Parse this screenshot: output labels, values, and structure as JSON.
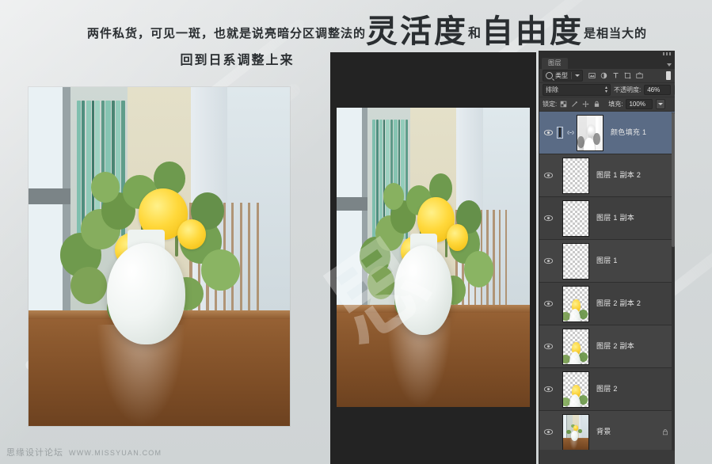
{
  "headline": {
    "line1_part1": "两件私货，可见一斑，也就是说亮暗分区调整法的",
    "line1_big1": "灵活度",
    "line1_conj": "和",
    "line1_big2": "自由度",
    "line1_tail": "是相当大的",
    "line2": "回到日系调整上来"
  },
  "photoshop": {
    "panel_tab": "图层",
    "filter": {
      "search_icon": "search-icon",
      "label": "类型",
      "dropdown_icon": "chevron-down-icon"
    },
    "filter_type_icons": [
      "pixel-layer-icon",
      "adjustment-layer-icon",
      "type-layer-icon",
      "shape-layer-icon",
      "smart-object-icon"
    ],
    "filter_toggle": "filter-enable-toggle",
    "blend_mode": "排除",
    "opacity_label": "不透明度:",
    "opacity_value": "46%",
    "lock_label": "锁定:",
    "lock_icons": [
      "lock-transparent-pixels-icon",
      "lock-image-pixels-icon",
      "lock-position-icon",
      "lock-all-icon"
    ],
    "fill_label": "填充:",
    "fill_value": "100%",
    "layers": [
      {
        "name": "颜色填充 1",
        "selected": true,
        "visible": true,
        "kind": "solid-color-fill",
        "has_mask": true,
        "fill_color": "#9e3c10",
        "locked": false
      },
      {
        "name": "图层 1 副本 2",
        "selected": false,
        "visible": true,
        "kind": "pixel",
        "has_mask": false,
        "locked": false
      },
      {
        "name": "图层 1 副本",
        "selected": false,
        "visible": true,
        "kind": "pixel",
        "has_mask": false,
        "locked": false
      },
      {
        "name": "图层 1",
        "selected": false,
        "visible": true,
        "kind": "pixel",
        "has_mask": false,
        "locked": false
      },
      {
        "name": "图层 2 副本 2",
        "selected": false,
        "visible": true,
        "kind": "pixel",
        "has_mask": false,
        "locked": false
      },
      {
        "name": "图层 2 副本",
        "selected": false,
        "visible": true,
        "kind": "pixel",
        "has_mask": false,
        "locked": false
      },
      {
        "name": "图层 2",
        "selected": false,
        "visible": true,
        "kind": "pixel",
        "has_mask": false,
        "locked": false
      },
      {
        "name": "背景",
        "selected": false,
        "visible": true,
        "kind": "background",
        "has_mask": false,
        "locked": true
      }
    ],
    "canvas_background": "#232323"
  },
  "footer": {
    "site_name": "思缘设计论坛",
    "url": "WWW.MISSYUAN.COM"
  },
  "colors": {
    "page_background": "#d6dadb",
    "panel_background": "#3a3a3a",
    "layer_row": "#444444",
    "selected_layer": "#5a6b85",
    "text": "#e6e6e6",
    "canvas": "#232323"
  }
}
